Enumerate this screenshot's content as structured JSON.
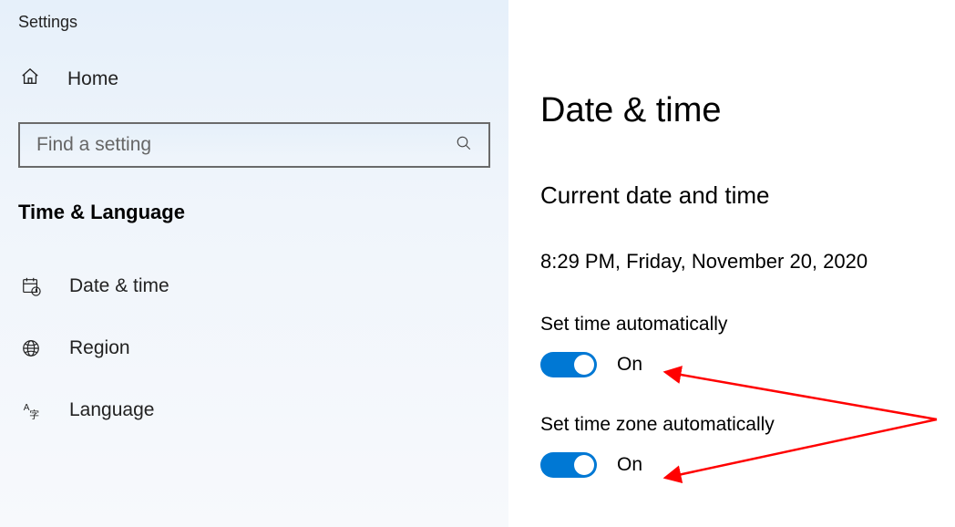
{
  "app_title": "Settings",
  "home_label": "Home",
  "search": {
    "placeholder": "Find a setting"
  },
  "section": "Time & Language",
  "sidebar": {
    "items": [
      {
        "label": "Date & time"
      },
      {
        "label": "Region"
      },
      {
        "label": "Language"
      }
    ]
  },
  "main": {
    "title": "Date & time",
    "subheader": "Current date and time",
    "datetime": "8:29 PM, Friday, November 20, 2020",
    "settings": [
      {
        "label": "Set time automatically",
        "state": "On",
        "on": true
      },
      {
        "label": "Set time zone automatically",
        "state": "On",
        "on": true
      }
    ]
  }
}
